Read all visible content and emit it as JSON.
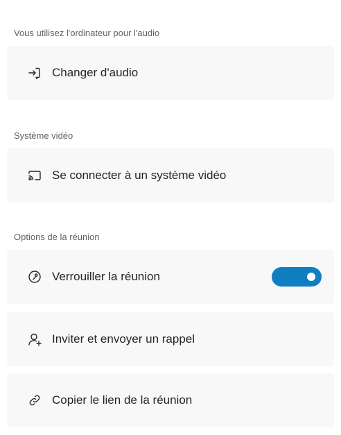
{
  "audio": {
    "header": "Vous utilisez l'ordinateur pour l'audio",
    "change_audio": {
      "label": "Changer d'audio",
      "icon": "audio-switch-icon"
    }
  },
  "video": {
    "header": "Système vidéo",
    "connect_video": {
      "label": "Se connecter à un système vidéo",
      "icon": "cast-icon"
    }
  },
  "meeting_options": {
    "header": "Options de la réunion",
    "lock_meeting": {
      "label": "Verrouiller la réunion",
      "icon": "lock-icon",
      "toggle_on": true
    },
    "invite": {
      "label": "Inviter et envoyer un rappel",
      "icon": "add-person-icon"
    },
    "copy_link": {
      "label": "Copier le lien de la réunion",
      "icon": "link-icon"
    }
  },
  "colors": {
    "toggle_on": "#0f7fc1",
    "card_background": "#f8f8f8",
    "section_header_text": "#616161",
    "label_text": "#242424"
  }
}
